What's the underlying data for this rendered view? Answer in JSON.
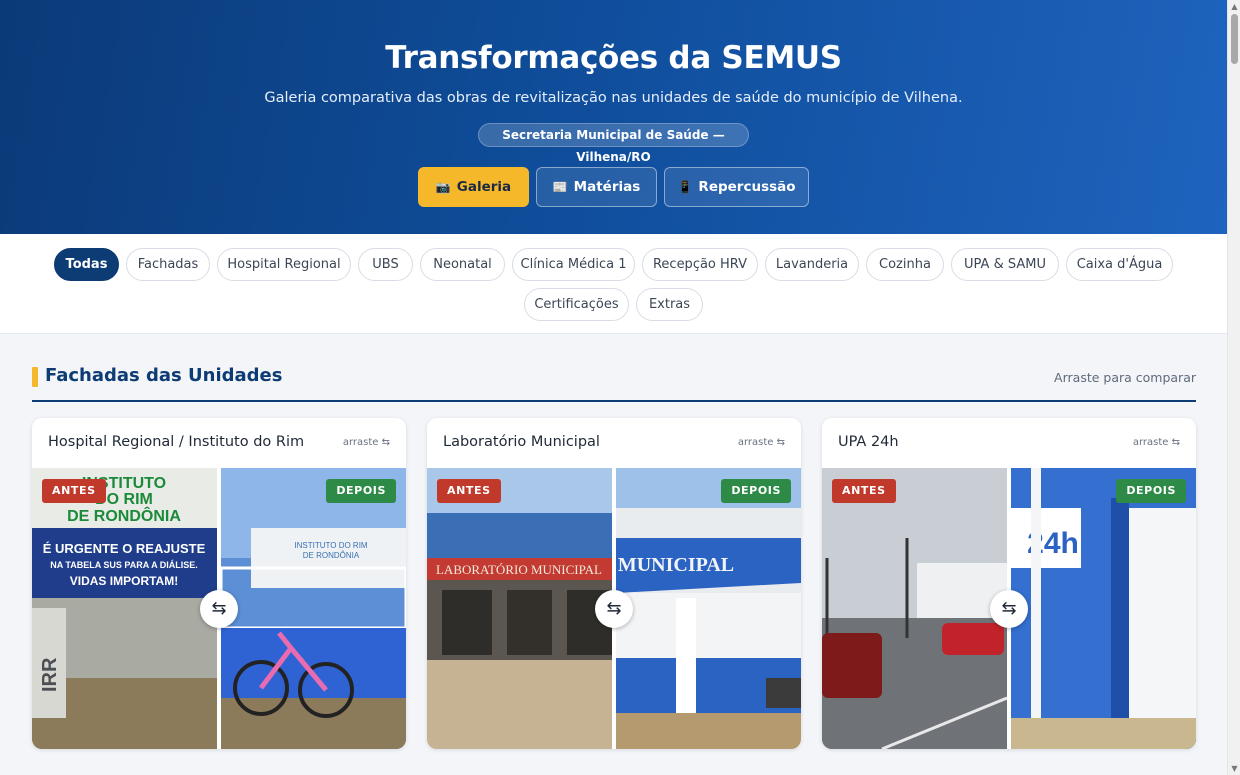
{
  "hero": {
    "title": "Transformações da SEMUS",
    "subtitle": "Galeria comparativa das obras de revitalização nas unidades de saúde do município de Vilhena.",
    "badge": "Secretaria Municipal de Saúde — Vilhena/RO",
    "tabs": [
      {
        "label": "Galeria",
        "icon": "camera-icon",
        "active": true
      },
      {
        "label": "Matérias",
        "icon": "newspaper-icon",
        "active": false
      },
      {
        "label": "Repercussão",
        "icon": "mobile-icon",
        "active": false
      }
    ]
  },
  "filters": [
    "Todas",
    "Fachadas",
    "Hospital Regional",
    "UBS",
    "Neonatal",
    "Clínica Médica 1",
    "Recepção HRV",
    "Lavanderia",
    "Cozinha",
    "UPA & SAMU",
    "Caixa d'Água",
    "Certificações",
    "Extras"
  ],
  "active_filter": "Todas",
  "section": {
    "title": "Fachadas das Unidades",
    "hint": "Arraste para comparar"
  },
  "labels": {
    "before": "ANTES",
    "after": "DEPOIS",
    "drag": "arraste ⇆",
    "handle": "⇆"
  },
  "cards": [
    {
      "title": "Hospital Regional / Instituto do Rim",
      "before_sign": [
        "INSTITUTO",
        "DO RIM",
        "DE RONDÔNIA"
      ],
      "before_banner": [
        "É URGENTE O REAJUSTE",
        "NA TABELA SUS PARA A DIÁLISE.",
        "VIDAS IMPORTAM!"
      ],
      "after_sign": [
        "INSTITUTO DO RIM",
        "DE RONDÔNIA"
      ]
    },
    {
      "title": "Laboratório Municipal",
      "before_sign": "LABORATÓRIO MUNICIPAL",
      "after_sign": "MUNICIPAL"
    },
    {
      "title": "UPA 24h",
      "after_sign": "24h"
    }
  ],
  "colors": {
    "hero_start": "#0b3a78",
    "hero_end": "#1e63be",
    "accent": "#f5b82a",
    "navy": "#0d3b73",
    "before_tag": "#c0392b",
    "after_tag": "#2e8b47"
  }
}
